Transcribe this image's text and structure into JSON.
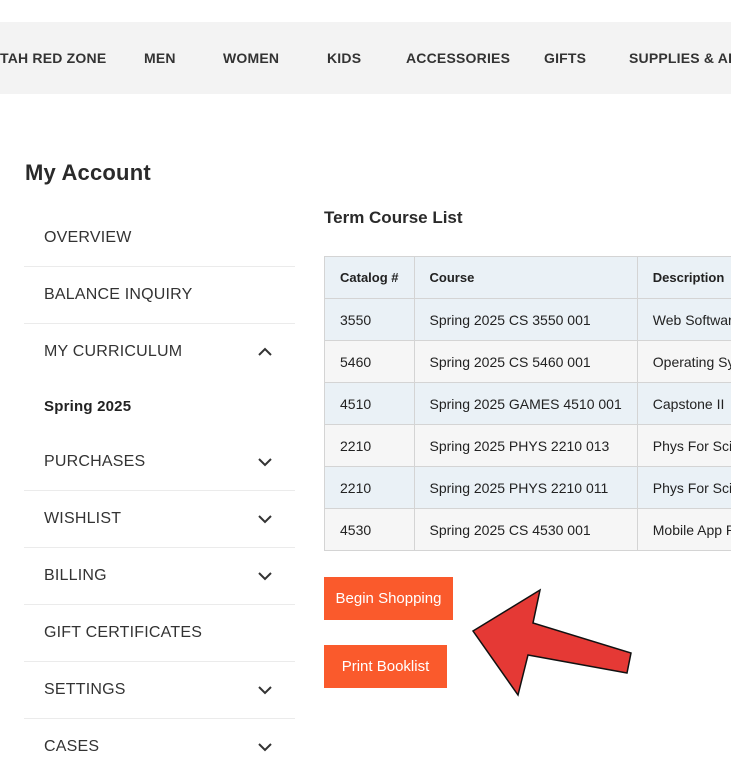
{
  "topnav": {
    "items": [
      "TAH RED ZONE",
      "MEN",
      "WOMEN",
      "KIDS",
      "ACCESSORIES",
      "GIFTS",
      "SUPPLIES & ART"
    ]
  },
  "account": {
    "title": "My Account"
  },
  "sidebar": {
    "items": [
      {
        "label": "OVERVIEW"
      },
      {
        "label": "BALANCE INQUIRY"
      },
      {
        "label": "MY CURRICULUM",
        "chevron": "chevron-up-icon"
      },
      {
        "label": "Spring 2025"
      },
      {
        "label": "PURCHASES",
        "chevron": "chevron-down-icon"
      },
      {
        "label": "WISHLIST",
        "chevron": "chevron-down-icon"
      },
      {
        "label": "BILLING",
        "chevron": "chevron-down-icon"
      },
      {
        "label": "GIFT CERTIFICATES"
      },
      {
        "label": "SETTINGS",
        "chevron": "chevron-down-icon"
      },
      {
        "label": "CASES",
        "chevron": "chevron-down-icon"
      }
    ]
  },
  "main": {
    "section_title": "Term Course List",
    "table": {
      "headers": [
        "Catalog #",
        "Course",
        "Description"
      ],
      "rows": [
        [
          "3550",
          "Spring 2025 CS 3550 001",
          "Web Software D"
        ],
        [
          "5460",
          "Spring 2025 CS 5460 001",
          "Operating Syste"
        ],
        [
          "4510",
          "Spring 2025 GAMES 4510 001",
          "Capstone II"
        ],
        [
          "2210",
          "Spring 2025 PHYS 2210 013",
          "Phys For Scien"
        ],
        [
          "2210",
          "Spring 2025 PHYS 2210 011",
          "Phys For Scien"
        ],
        [
          "4530",
          "Spring 2025 CS 4530 001",
          "Mobile App Pro"
        ]
      ]
    },
    "buttons": {
      "begin_shopping": "Begin Shopping",
      "print_booklist": "Print Booklist"
    }
  },
  "colors": {
    "accent_button": "#fa5a2c",
    "annotation_arrow": "#e53935",
    "table_header_bg": "#eaf1f6",
    "nav_bg": "#f3f3f3"
  }
}
